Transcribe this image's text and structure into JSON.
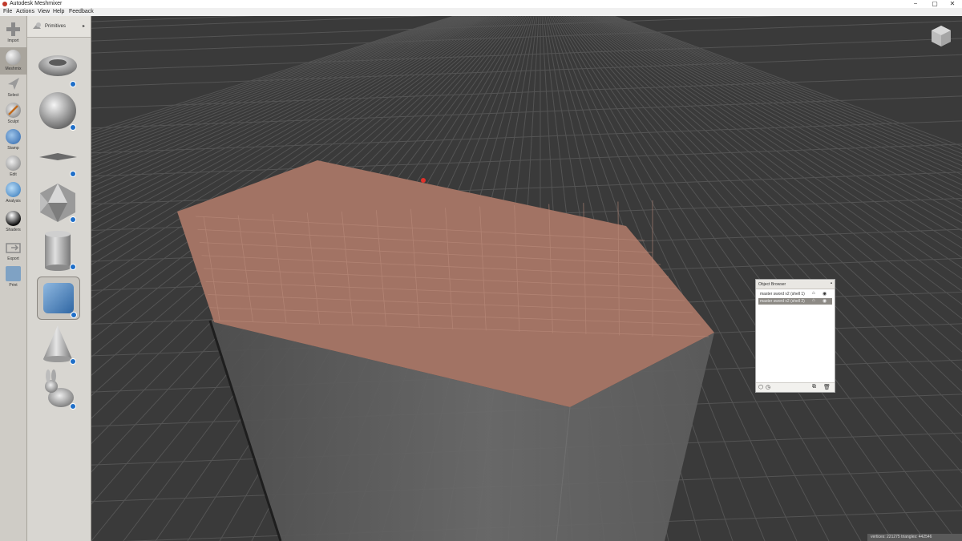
{
  "window": {
    "title": "Autodesk Meshmixer",
    "minimize": "−",
    "maximize": "▢",
    "close": "✕"
  },
  "menu": [
    "File",
    "Actions",
    "View",
    "Help",
    "Feedback"
  ],
  "tools": [
    {
      "id": "import",
      "label": "Import",
      "icon": "plus-icon"
    },
    {
      "id": "meshmix",
      "label": "Meshmix",
      "icon": "meshmix-icon",
      "active": true
    },
    {
      "id": "select",
      "label": "Select",
      "icon": "select-arrow-icon"
    },
    {
      "id": "sculpt",
      "label": "Sculpt",
      "icon": "brush-icon"
    },
    {
      "id": "stamp",
      "label": "Stamp",
      "icon": "stamp-icon"
    },
    {
      "id": "edit",
      "label": "Edit",
      "icon": "edit-icon"
    },
    {
      "id": "analysis",
      "label": "Analysis",
      "icon": "analysis-icon"
    },
    {
      "id": "shaders",
      "label": "Shaders",
      "icon": "shader-sphere-icon"
    },
    {
      "id": "export",
      "label": "Export",
      "icon": "export-icon"
    },
    {
      "id": "print",
      "label": "Print",
      "icon": "print-icon"
    }
  ],
  "palette": {
    "title": "Primitives",
    "items": [
      {
        "name": "torus",
        "icon": "torus-icon"
      },
      {
        "name": "sphere",
        "icon": "sphere-icon"
      },
      {
        "name": "plane",
        "icon": "plane-icon"
      },
      {
        "name": "icosahedron",
        "icon": "icosahedron-icon"
      },
      {
        "name": "cylinder",
        "icon": "cylinder-icon"
      },
      {
        "name": "cube",
        "icon": "cube-icon",
        "selected": true
      },
      {
        "name": "cone",
        "icon": "cone-icon"
      },
      {
        "name": "bunny",
        "icon": "bunny-icon"
      }
    ]
  },
  "object_browser": {
    "title": "Object Browser",
    "rows": [
      {
        "name": "master sword v2 (shell 1)",
        "selected": false
      },
      {
        "name": "master sword v2 (shell 2)",
        "selected": true
      }
    ]
  },
  "status": "vertices: 221275 triangles: 442546",
  "colors": {
    "face": "#a57565",
    "body": "#6a6a6a",
    "grid_bg": "#3a3a3a",
    "selection_badge": "#1e6ec8",
    "pivot": "#e0302a"
  }
}
